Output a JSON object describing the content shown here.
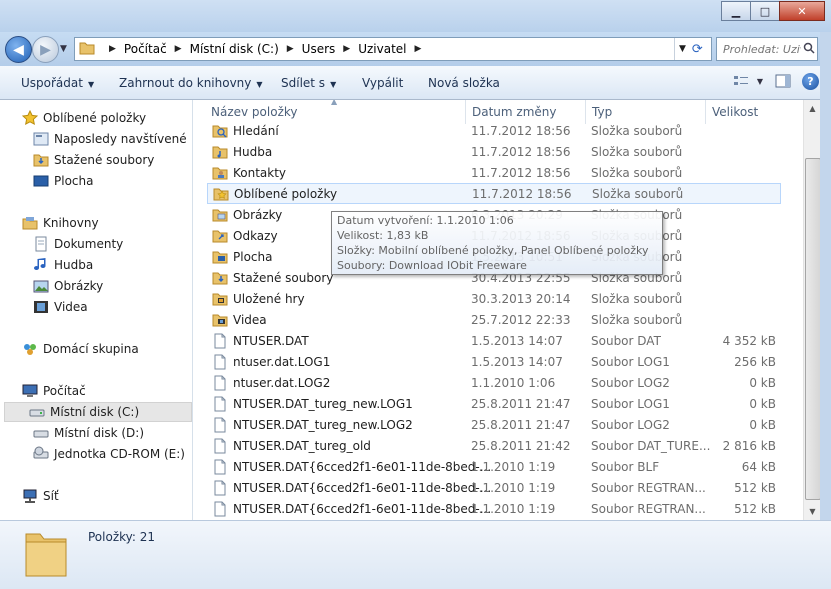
{
  "window": {
    "buttons": {
      "minimize": "▁",
      "maximize": "□",
      "close": "✕"
    }
  },
  "address": {
    "crumbs": [
      "Počítač",
      "Místní disk (C:)",
      "Users",
      "Uzivatel"
    ],
    "search_placeholder": "Prohledat: Uzivatel"
  },
  "toolbar": {
    "organize": "Uspořádat",
    "include_library": "Zahrnout do knihovny",
    "share": "Sdílet s",
    "burn": "Vypálit",
    "new_folder": "Nová složka",
    "help": "?"
  },
  "sidebar": {
    "favorites": {
      "label": "Oblíbené položky",
      "items": [
        "Naposledy navštívené",
        "Stažené soubory",
        "Plocha"
      ]
    },
    "libraries": {
      "label": "Knihovny",
      "items": [
        "Dokumenty",
        "Hudba",
        "Obrázky",
        "Videa"
      ]
    },
    "homegroup": "Domácí skupina",
    "computer": {
      "label": "Počítač",
      "items": [
        "Místní disk (C:)",
        "Místní disk (D:)",
        "Jednotka CD-ROM (E:)"
      ]
    },
    "network": "Síť"
  },
  "columns": {
    "name": "Název položky",
    "date": "Datum změny",
    "type": "Typ",
    "size": "Velikost"
  },
  "files": [
    {
      "name": "Hledání",
      "date": "11.7.2012 18:56",
      "type": "Složka souborů",
      "size": "",
      "icon": "search-folder"
    },
    {
      "name": "Hudba",
      "date": "11.7.2012 18:56",
      "type": "Složka souborů",
      "size": "",
      "icon": "music-folder"
    },
    {
      "name": "Kontakty",
      "date": "11.7.2012 18:56",
      "type": "Složka souborů",
      "size": "",
      "icon": "contacts-folder"
    },
    {
      "name": "Oblíbené položky",
      "date": "11.7.2012 18:56",
      "type": "Složka souborů",
      "size": "",
      "icon": "favorites-folder"
    },
    {
      "name": "Obrázky",
      "date": "6.3.2013 20:29",
      "type": "Složka souborů",
      "size": "",
      "icon": "pictures-folder"
    },
    {
      "name": "Odkazy",
      "date": "11.7.2012 18:56",
      "type": "Složka souborů",
      "size": "",
      "icon": "links-folder"
    },
    {
      "name": "Plocha",
      "date": "1.5.2013 10:51",
      "type": "Složka souborů",
      "size": "",
      "icon": "desktop-folder"
    },
    {
      "name": "Stažené soubory",
      "date": "30.4.2013 22:55",
      "type": "Složka souborů",
      "size": "",
      "icon": "downloads-folder"
    },
    {
      "name": "Uložené hry",
      "date": "30.3.2013 20:14",
      "type": "Složka souborů",
      "size": "",
      "icon": "games-folder"
    },
    {
      "name": "Videa",
      "date": "25.7.2012 22:33",
      "type": "Složka souborů",
      "size": "",
      "icon": "videos-folder"
    },
    {
      "name": "NTUSER.DAT",
      "date": "1.5.2013 14:07",
      "type": "Soubor DAT",
      "size": "4 352 kB",
      "icon": "file"
    },
    {
      "name": "ntuser.dat.LOG1",
      "date": "1.5.2013 14:07",
      "type": "Soubor LOG1",
      "size": "256 kB",
      "icon": "file"
    },
    {
      "name": "ntuser.dat.LOG2",
      "date": "1.1.2010 1:06",
      "type": "Soubor LOG2",
      "size": "0 kB",
      "icon": "file"
    },
    {
      "name": "NTUSER.DAT_tureg_new.LOG1",
      "date": "25.8.2011 21:47",
      "type": "Soubor LOG1",
      "size": "0 kB",
      "icon": "file"
    },
    {
      "name": "NTUSER.DAT_tureg_new.LOG2",
      "date": "25.8.2011 21:47",
      "type": "Soubor LOG2",
      "size": "0 kB",
      "icon": "file"
    },
    {
      "name": "NTUSER.DAT_tureg_old",
      "date": "25.8.2011 21:42",
      "type": "Soubor DAT_TURE...",
      "size": "2 816 kB",
      "icon": "file"
    },
    {
      "name": "NTUSER.DAT{6cced2f1-6e01-11de-8bed-...",
      "date": "1.1.2010 1:19",
      "type": "Soubor BLF",
      "size": "64 kB",
      "icon": "file"
    },
    {
      "name": "NTUSER.DAT{6cced2f1-6e01-11de-8bed-...",
      "date": "1.1.2010 1:19",
      "type": "Soubor REGTRAN...",
      "size": "512 kB",
      "icon": "file"
    },
    {
      "name": "NTUSER.DAT{6cced2f1-6e01-11de-8bed-...",
      "date": "1.1.2010 1:19",
      "type": "Soubor REGTRAN...",
      "size": "512 kB",
      "icon": "file"
    }
  ],
  "tooltip": {
    "created": "Datum vytvoření: 1.1.2010 1:06",
    "size": "Velikost: 1,83 kB",
    "folders": "Složky: Mobilní oblíbené položky, Panel Oblíbené položky",
    "files": "Soubory: Download IObit Freeware"
  },
  "status": {
    "count": "Položky: 21"
  },
  "colors": {
    "folder": "#e8c26a",
    "accent": "#1f5fb4",
    "hover_bg": "#eef5fd",
    "hover_border": "#b8d6fb"
  }
}
